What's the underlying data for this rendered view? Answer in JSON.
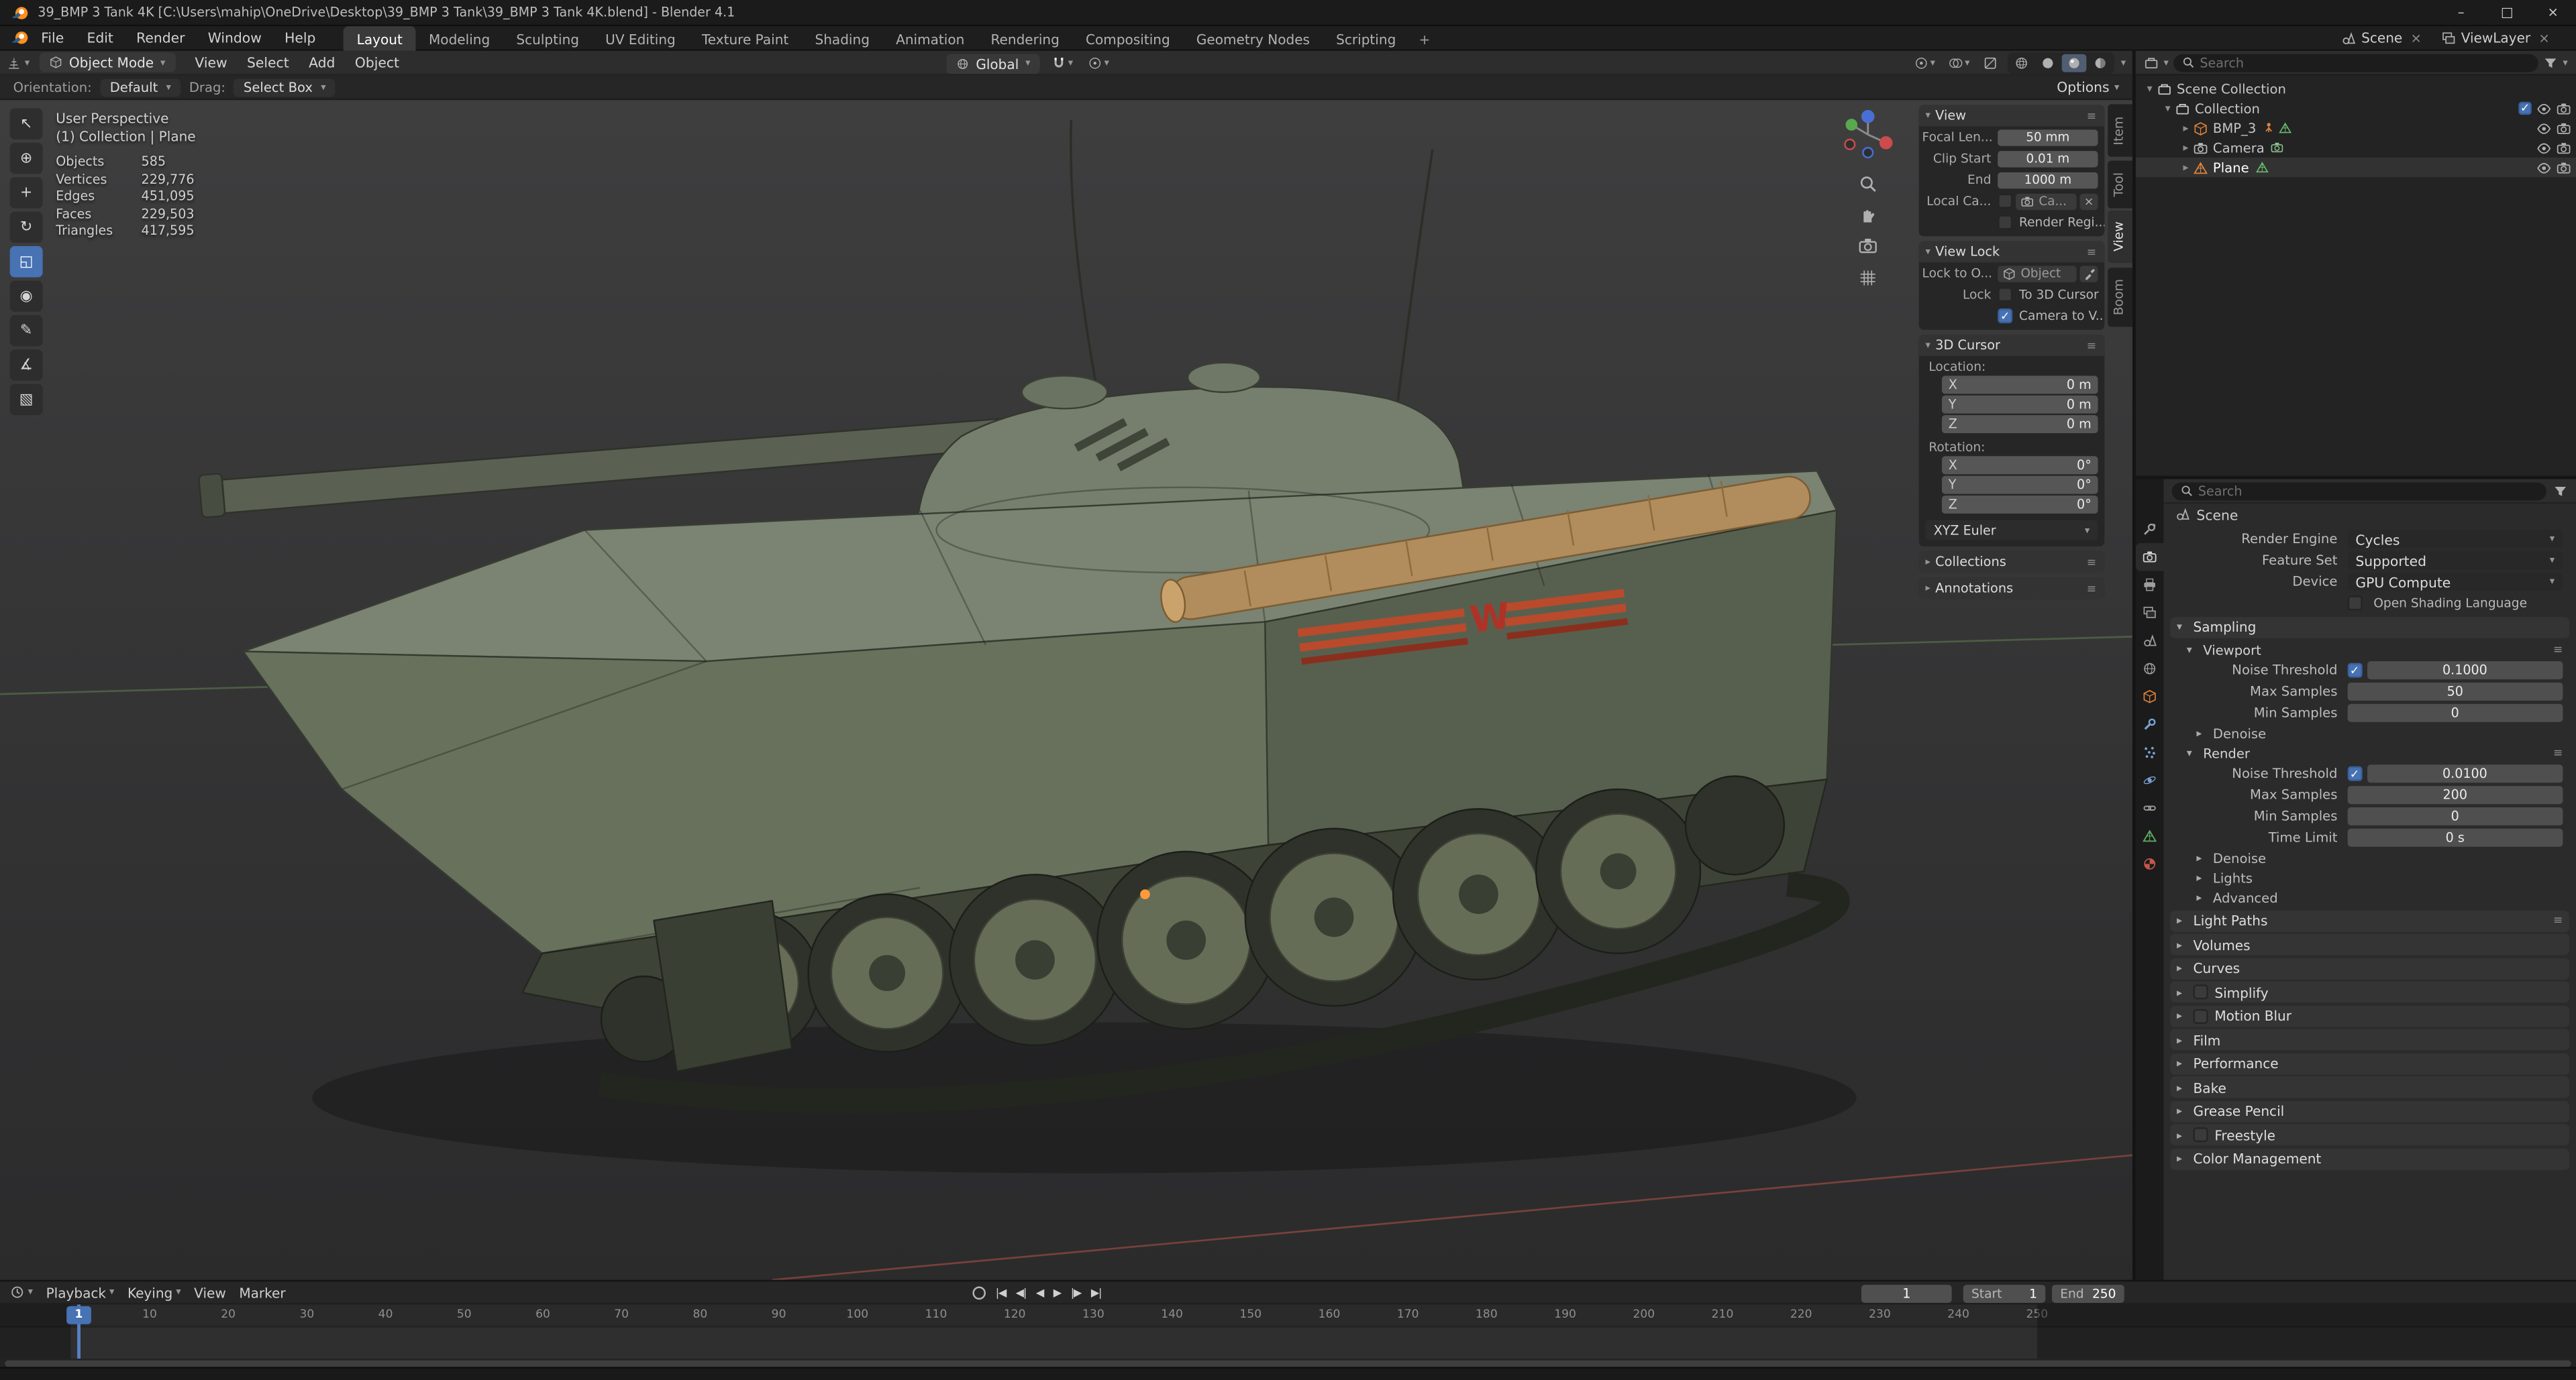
{
  "window": {
    "title": "39_BMP 3 Tank 4K [C:\\Users\\mahip\\OneDrive\\Desktop\\39_BMP 3 Tank\\39_BMP 3 Tank 4K.blend] - Blender 4.1",
    "controls": {
      "minimize": "–",
      "maximize": "□",
      "close": "×"
    }
  },
  "menubar": {
    "menus": [
      "File",
      "Edit",
      "Render",
      "Window",
      "Help"
    ],
    "workspaces": [
      "Layout",
      "Modeling",
      "Sculpting",
      "UV Editing",
      "Texture Paint",
      "Shading",
      "Animation",
      "Rendering",
      "Compositing",
      "Geometry Nodes",
      "Scripting"
    ],
    "active_workspace": "Layout",
    "add_workspace_label": "+",
    "scene_name": "Scene",
    "view_layer_name": "ViewLayer"
  },
  "tool_header": {
    "mode": "Object Mode",
    "menus": [
      "View",
      "Select",
      "Add",
      "Object"
    ],
    "transform_orientation": "Global",
    "options_label": "Options"
  },
  "tool_settings": {
    "orientation_label": "Orientation:",
    "orientation_value": "Default",
    "drag_label": "Drag:",
    "drag_value": "Select Box"
  },
  "toolbar": {
    "tools": [
      "tweak-select",
      "cursor",
      "move",
      "rotate",
      "scale",
      "transform",
      "annotate",
      "measure",
      "add-cube"
    ],
    "active_tool": "scale"
  },
  "viewport": {
    "view_label": "User Perspective",
    "context_label": "(1) Collection | Plane",
    "stats": [
      {
        "label": "Objects",
        "value": "585"
      },
      {
        "label": "Vertices",
        "value": "229,776"
      },
      {
        "label": "Edges",
        "value": "451,095"
      },
      {
        "label": "Faces",
        "value": "229,503"
      },
      {
        "label": "Triangles",
        "value": "417,595"
      }
    ],
    "side_tabs": [
      "Item",
      "Tool",
      "View",
      "Boom"
    ],
    "active_side_tab": "View"
  },
  "n_panel": {
    "view": {
      "title": "View",
      "rows": [
        {
          "label": "Focal Len...",
          "value": "50 mm"
        },
        {
          "label": "Clip Start",
          "value": "0.01 m"
        },
        {
          "label": "End",
          "value": "1000 m"
        }
      ],
      "local_camera_label": "Local Ca...",
      "local_camera_value": "Ca...",
      "render_region_label": "Render Regi..."
    },
    "view_lock": {
      "title": "View Lock",
      "lock_to_label": "Lock to O...",
      "lock_to_placeholder": "Object",
      "lock_label": "Lock",
      "to_3d_cursor_label": "To 3D Cursor",
      "camera_to_view_label": "Camera to V..."
    },
    "cursor_3d": {
      "title": "3D Cursor",
      "location_label": "Location:",
      "location": [
        {
          "axis": "X",
          "value": "0 m"
        },
        {
          "axis": "Y",
          "value": "0 m"
        },
        {
          "axis": "Z",
          "value": "0 m"
        }
      ],
      "rotation_label": "Rotation:",
      "rotation": [
        {
          "axis": "X",
          "value": "0°"
        },
        {
          "axis": "Y",
          "value": "0°"
        },
        {
          "axis": "Z",
          "value": "0°"
        }
      ],
      "rotation_mode": "XYZ Euler"
    },
    "collections_title": "Collections",
    "annotations_title": "Annotations"
  },
  "outliner": {
    "search_placeholder": "Search",
    "rows": [
      {
        "label": "Scene Collection",
        "level": 0,
        "icon": "collection",
        "expand": "open"
      },
      {
        "label": "Collection",
        "level": 1,
        "icon": "collection",
        "expand": "open",
        "checkbox": true,
        "eye": true,
        "camera": true
      },
      {
        "label": "BMP_3",
        "level": 2,
        "icon": "object-orange",
        "expand": "closed",
        "badges": [
          "armature-orange",
          "mesh-green"
        ],
        "eye": true,
        "camera": true
      },
      {
        "label": "Camera",
        "level": 2,
        "icon": "camera",
        "expand": "closed",
        "badges": [
          "camera-green"
        ],
        "eye": true,
        "camera": true
      },
      {
        "label": "Plane",
        "level": 2,
        "icon": "mesh-orange",
        "expand": "closed",
        "badges": [
          "mesh-green"
        ],
        "eye": true,
        "camera": true,
        "active": true
      }
    ]
  },
  "properties": {
    "search_placeholder": "Search",
    "breadcrumb": "Scene",
    "tabs": [
      "tool",
      "render",
      "output",
      "view-layer",
      "scene",
      "world",
      "object",
      "modifiers",
      "particles",
      "physics",
      "constraints",
      "object-data",
      "material"
    ],
    "active_tab": "render",
    "render_engine_label": "Render Engine",
    "render_engine": "Cycles",
    "feature_set_label": "Feature Set",
    "feature_set": "Supported",
    "device_label": "Device",
    "device": "GPU Compute",
    "osl_label": "Open Shading Language",
    "sampling": {
      "title": "Sampling",
      "viewport": {
        "title": "Viewport",
        "noise_threshold_label": "Noise Threshold",
        "noise_threshold": "0.1000",
        "max_samples_label": "Max Samples",
        "max_samples": "50",
        "min_samples_label": "Min Samples",
        "min_samples": "0",
        "denoise_title": "Denoise"
      },
      "render": {
        "title": "Render",
        "noise_threshold_label": "Noise Threshold",
        "noise_threshold": "0.0100",
        "max_samples_label": "Max Samples",
        "max_samples": "200",
        "min_samples_label": "Min Samples",
        "min_samples": "0",
        "time_limit_label": "Time Limit",
        "time_limit": "0 s",
        "denoise_title": "Denoise"
      },
      "lights_title": "Lights",
      "advanced_title": "Advanced"
    },
    "collapsed_panels": [
      {
        "label": "Light Paths",
        "grip": true
      },
      {
        "label": "Volumes"
      },
      {
        "label": "Curves"
      },
      {
        "label": "Simplify",
        "checkbox": true
      },
      {
        "label": "Motion Blur",
        "checkbox": true
      },
      {
        "label": "Film"
      },
      {
        "label": "Performance"
      },
      {
        "label": "Bake"
      },
      {
        "label": "Grease Pencil"
      },
      {
        "label": "Freestyle",
        "checkbox": true
      },
      {
        "label": "Color Management"
      }
    ]
  },
  "timeline": {
    "menus": [
      "Playback",
      "Keying",
      "View",
      "Marker"
    ],
    "transport": [
      "jump-start",
      "prev-keyframe",
      "play-reverse",
      "play",
      "next-keyframe",
      "jump-end"
    ],
    "current_frame": "1",
    "start_label": "Start",
    "start_value": "1",
    "end_label": "End",
    "end_value": "250",
    "ticks": [
      10,
      20,
      30,
      40,
      50,
      60,
      70,
      80,
      90,
      100,
      110,
      120,
      130,
      140,
      150,
      160,
      170,
      180,
      190,
      200,
      210,
      220,
      230,
      240,
      250
    ]
  },
  "colors": {
    "accent": "#4772b3",
    "playhead": "#5680c2",
    "object_orange": "#e0833b",
    "mesh_green": "#6abf6e"
  }
}
